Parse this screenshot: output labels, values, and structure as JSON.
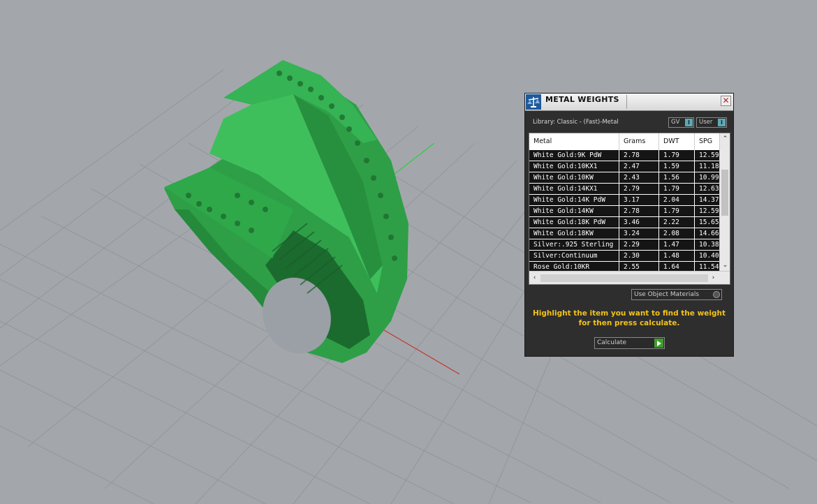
{
  "viewport": {
    "model": "ring-3d-model",
    "colors": {
      "background": "#a3a7ac",
      "grid": "#8f949a",
      "model": "#2fa84a",
      "x_axis": "#c0392b",
      "y_axis": "#2ecc40"
    }
  },
  "panel": {
    "title": "METAL WEIGHTS",
    "close_glyph": "✕",
    "library_label": "Library: Classic - (Fast)-Metal",
    "toggle_gv": "GV",
    "toggle_user": "User",
    "toggle_knob": "I",
    "columns": [
      "Metal",
      "Grams",
      "DWT",
      "SPG"
    ],
    "rows": [
      [
        "White Gold:9K PdW",
        "2.78",
        "1.79",
        "12.59"
      ],
      [
        "White Gold:10KX1",
        "2.47",
        "1.59",
        "11.18"
      ],
      [
        "White Gold:10KW",
        "2.43",
        "1.56",
        "10.99"
      ],
      [
        "White Gold:14KX1",
        "2.79",
        "1.79",
        "12.63"
      ],
      [
        "White Gold:14K PdW",
        "3.17",
        "2.04",
        "14.37"
      ],
      [
        "White Gold:14KW",
        "2.78",
        "1.79",
        "12.59"
      ],
      [
        "White Gold:18K PdW",
        "3.46",
        "2.22",
        "15.65"
      ],
      [
        "White Gold:18KW",
        "3.24",
        "2.08",
        "14.66"
      ],
      [
        "Silver:.925 Sterling",
        "2.29",
        "1.47",
        "10.38"
      ],
      [
        "Silver:Continuum",
        "2.30",
        "1.48",
        "10.40"
      ],
      [
        "Rose Gold:10KR",
        "2.55",
        "1.64",
        "11.54"
      ]
    ],
    "use_object_materials": "Use Object Materials",
    "help_text": "Highlight the item you want to find the weight for then press calculate.",
    "calculate": "Calculate",
    "colors": {
      "bg": "#2e2e2e",
      "accent": "#f2c21b",
      "go": "#3f9d2b",
      "toggle": "#5fa8b5"
    }
  }
}
